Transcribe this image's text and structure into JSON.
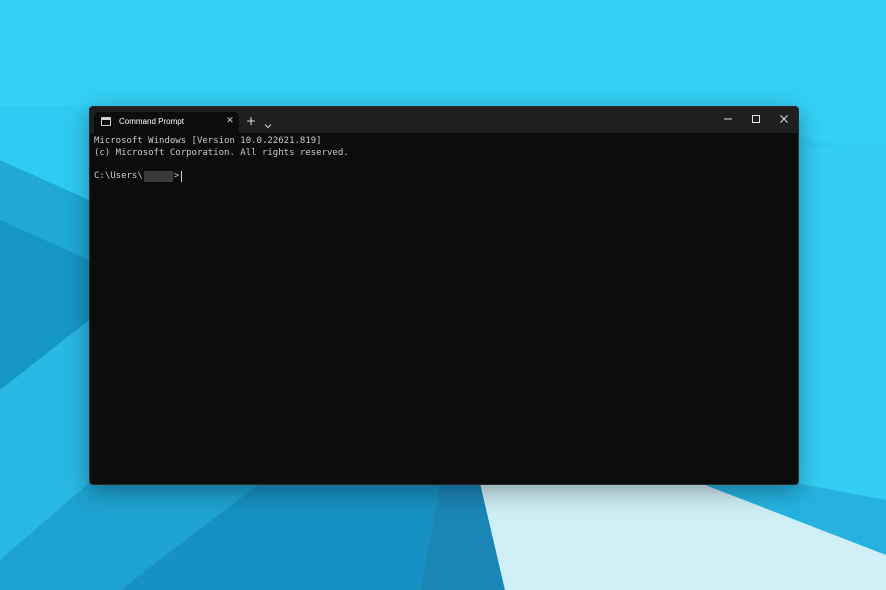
{
  "window": {
    "tab_title": "Command Prompt",
    "tab_close_symbol": "✕",
    "new_tab_symbol": "+",
    "dropdown_icon": "chevron-down-icon",
    "minimize_icon": "minimize-icon",
    "maximize_icon": "maximize-icon",
    "close_icon": "close-icon"
  },
  "terminal": {
    "lines": [
      "Microsoft Windows [Version 10.0.22621.819]",
      "(c) Microsoft Corporation. All rights reserved."
    ],
    "prompt_prefix": "C:\\Users\\",
    "prompt_suffix": ">"
  },
  "colors": {
    "terminal_background": "#0c0c0c",
    "titlebar_background": "#1f1f1f",
    "terminal_text": "#cccccc",
    "desktop_accent": "#2ec8f0"
  }
}
